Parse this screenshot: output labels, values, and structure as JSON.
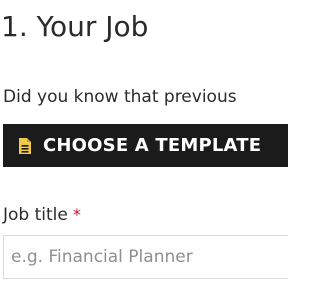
{
  "section": {
    "title": "1. Your Job",
    "intro_text": "Did you know that previous"
  },
  "template_button": {
    "label": "CHOOSE A TEMPLATE",
    "icon": "document-icon",
    "background": "#1b1b1b",
    "icon_color": "#f2c94c"
  },
  "job_title_field": {
    "label": "Job title",
    "required_marker": "*",
    "required_color": "#c8102e",
    "value": "",
    "placeholder": "e.g. Financial Planner"
  }
}
